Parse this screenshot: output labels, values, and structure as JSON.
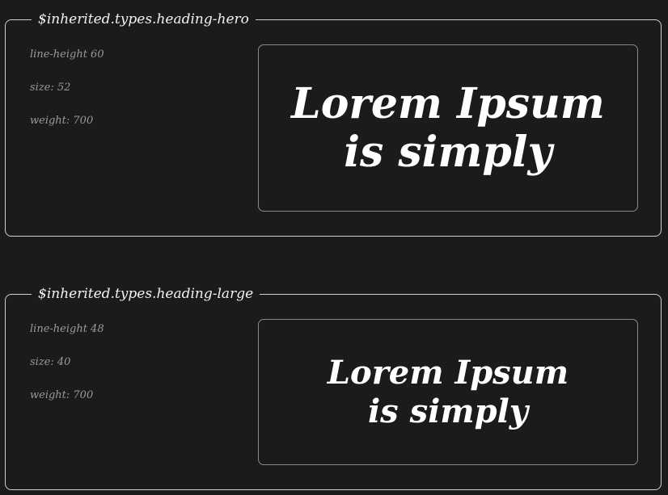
{
  "tokens": [
    {
      "name": "$inherited.types.heading-hero",
      "properties": [
        "line-height 60",
        "size: 52",
        "weight: 700"
      ],
      "preview_text": "Lorem Ipsum is simply"
    },
    {
      "name": "$inherited.types.heading-large",
      "properties": [
        "line-height 48",
        "size: 40",
        "weight: 700"
      ],
      "preview_text": "Lorem Ipsum is simply"
    }
  ]
}
